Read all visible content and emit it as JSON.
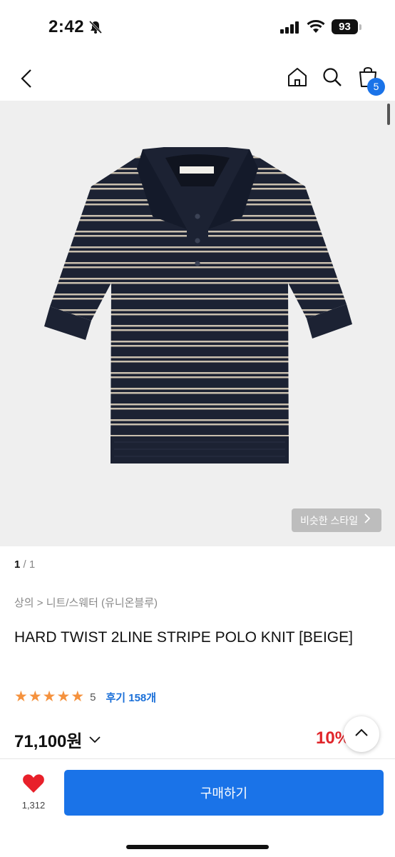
{
  "status_bar": {
    "time": "2:42",
    "battery": "93"
  },
  "header": {
    "cart_count": "5"
  },
  "image": {
    "similar_style_label": "비슷한 스타일"
  },
  "pagination": {
    "current": "1",
    "separator": " / ",
    "total": "1"
  },
  "breadcrumb": "상의 > 니트/스웨터 (유니온블루)",
  "product": {
    "title": "HARD TWIST 2LINE STRIPE POLO KNIT [BEIGE]",
    "rating_value": "5",
    "review_label": "후기 158개",
    "stars_count": 5,
    "price": "71,100원",
    "discount": "10%",
    "discount_suffix": "↓"
  },
  "bottom_bar": {
    "like_count": "1,312",
    "buy_label": "구매하기"
  },
  "colors": {
    "accent": "#1a73e8",
    "star": "#f5923e",
    "discount": "#e0252a",
    "like": "#e8202a"
  }
}
